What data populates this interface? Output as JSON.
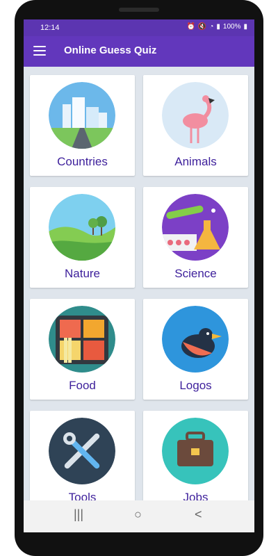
{
  "status_bar": {
    "time": "12:14",
    "battery": "100%"
  },
  "app_bar": {
    "title": "Online Guess Quiz",
    "menu_icon": "hamburger-menu-icon"
  },
  "categories": [
    {
      "label": "Countries",
      "icon": "city-icon",
      "color": "#69b6e8"
    },
    {
      "label": "Animals",
      "icon": "flamingo-icon",
      "color": "#d8e8f4"
    },
    {
      "label": "Nature",
      "icon": "landscape-icon",
      "color": "#6cc3e8"
    },
    {
      "label": "Science",
      "icon": "lab-flask-icon",
      "color": "#7b3fc5"
    },
    {
      "label": "Food",
      "icon": "food-tray-icon",
      "color": "#2f8c8b"
    },
    {
      "label": "Logos",
      "icon": "bird-logo-icon",
      "color": "#2e95dc"
    },
    {
      "label": "Tools",
      "icon": "wrench-screwdriver-icon",
      "color": "#2f4356"
    },
    {
      "label": "Jobs",
      "icon": "briefcase-icon",
      "color": "#37c3bb"
    }
  ],
  "nav_bar": {
    "recent": "|||",
    "home": "○",
    "back": "<"
  }
}
